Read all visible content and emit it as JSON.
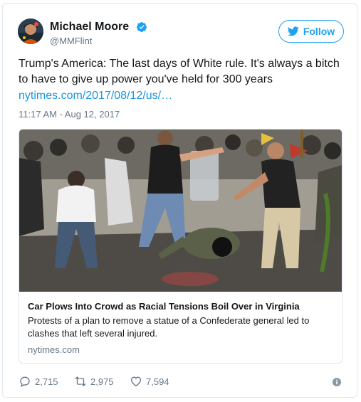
{
  "tweet": {
    "author_name": "Michael Moore",
    "author_handle": "@MMFlint",
    "follow_label": "Follow",
    "text": "Trump's America: The last days of White rule. It's always a bitch to have to give up power you've held for 300 years",
    "link": "nytimes.com/2017/08/12/us/…",
    "timestamp": "11:17 AM - Aug 12, 2017"
  },
  "card": {
    "title": "Car Plows Into Crowd as Racial Tensions Boil Over in Virginia",
    "description": "Protests of a plan to remove a statue of a Confederate general led to clashes that left several injured.",
    "domain": "nytimes.com"
  },
  "actions": {
    "replies": "2,715",
    "retweets": "2,975",
    "likes": "7,594"
  },
  "colors": {
    "accent": "#1da1f2",
    "link": "#1b95e0",
    "muted": "#657786"
  },
  "icons": [
    "verified-badge-icon",
    "bird-icon",
    "reply-icon",
    "retweet-icon",
    "like-icon",
    "info-icon"
  ]
}
